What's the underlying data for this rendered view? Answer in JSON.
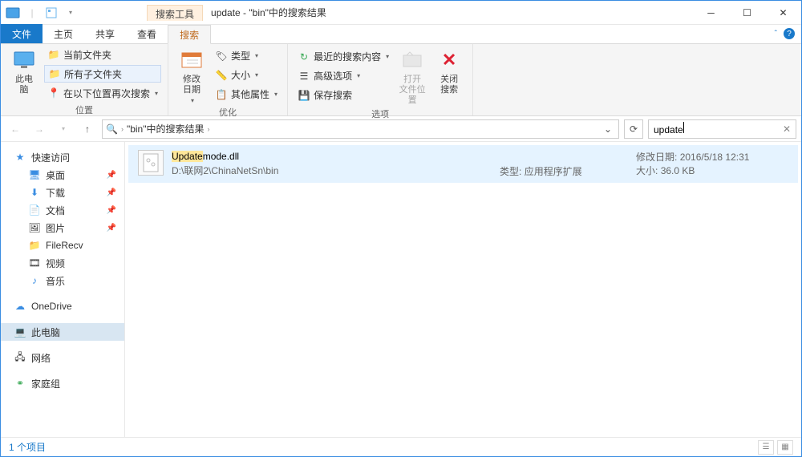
{
  "title": {
    "tool_tab": "搜索工具",
    "text": "update - \"bin\"中的搜索结果"
  },
  "tabs": {
    "file": "文件",
    "home": "主页",
    "share": "共享",
    "view": "查看",
    "search": "搜索"
  },
  "ribbon": {
    "location": {
      "this_pc": "此电\n脑",
      "current_folder": "当前文件夹",
      "all_subfolders": "所有子文件夹",
      "search_again_in": "在以下位置再次搜索",
      "group": "位置"
    },
    "refine": {
      "date": "修改\n日期",
      "kind": "类型",
      "size": "大小",
      "other": "其他属性",
      "group": "优化"
    },
    "options": {
      "recent": "最近的搜索内容",
      "advanced": "高级选项",
      "save": "保存搜索",
      "open_loc": "打开\n文件位置",
      "close": "关闭\n搜索",
      "group": "选项"
    }
  },
  "address": {
    "crumb": "\"bin\"中的搜索结果"
  },
  "search": {
    "value": "update"
  },
  "sidebar": {
    "quick": "快速访问",
    "desktop": "桌面",
    "downloads": "下载",
    "documents": "文档",
    "pictures": "图片",
    "filerecv": "FileRecv",
    "videos": "视频",
    "music": "音乐",
    "onedrive": "OneDrive",
    "thispc": "此电脑",
    "network": "网络",
    "homegroup": "家庭组"
  },
  "result": {
    "name_hl": "Update",
    "name_rest": "mode.dll",
    "path": "D:\\联网2\\ChinaNetSn\\bin",
    "type_label": "类型:",
    "type_value": "应用程序扩展",
    "date_label": "修改日期:",
    "date_value": "2016/5/18 12:31",
    "size_label": "大小:",
    "size_value": "36.0 KB"
  },
  "status": {
    "count": "1 个项目"
  }
}
